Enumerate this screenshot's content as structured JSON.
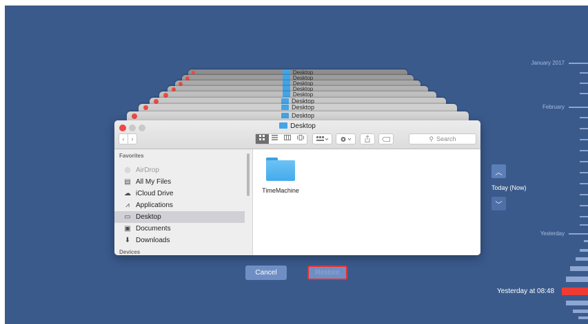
{
  "window": {
    "title": "Desktop",
    "stack_titles": [
      "Desktop",
      "Desktop",
      "Desktop",
      "Desktop",
      "Desktop",
      "Desktop",
      "Desktop",
      "Desktop"
    ]
  },
  "toolbar": {
    "back_icon": "‹",
    "forward_icon": "›",
    "view_modes": [
      "icon-view-icon",
      "list-view-icon",
      "column-view-icon",
      "cover-flow-icon"
    ],
    "search_placeholder": "Search"
  },
  "sidebar": {
    "favorites_header": "Favorites",
    "items": [
      {
        "label": "AirDrop",
        "icon": "airdrop-icon",
        "dim": true
      },
      {
        "label": "All My Files",
        "icon": "all-files-icon"
      },
      {
        "label": "iCloud Drive",
        "icon": "cloud-icon"
      },
      {
        "label": "Applications",
        "icon": "applications-icon"
      },
      {
        "label": "Desktop",
        "icon": "desktop-icon",
        "selected": true
      },
      {
        "label": "Documents",
        "icon": "documents-icon"
      },
      {
        "label": "Downloads",
        "icon": "downloads-icon"
      }
    ],
    "devices_header": "Devices"
  },
  "content": {
    "items": [
      {
        "label": "TimeMachine",
        "icon": "folder-icon"
      }
    ]
  },
  "buttons": {
    "cancel": "Cancel",
    "restore": "Restore"
  },
  "navigation": {
    "today_label": "Today (Now)"
  },
  "timeline": {
    "labels": [
      "January 2017",
      "February",
      "Yesterday"
    ],
    "current_label": "Yesterday at 08:48"
  },
  "colors": {
    "background": "#3a5a8c",
    "highlight": "#e8302e",
    "timeline_current": "#f03a34"
  }
}
